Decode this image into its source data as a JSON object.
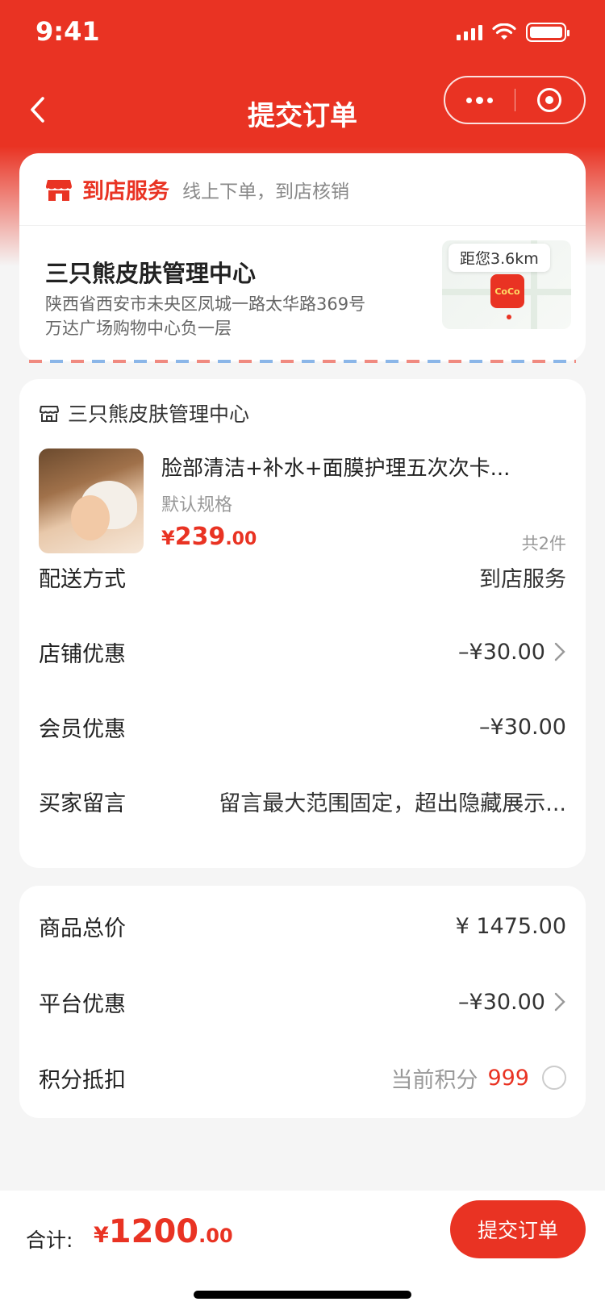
{
  "status_bar": {
    "time": "9:41"
  },
  "nav": {
    "title": "提交订单",
    "back_icon": "chevron-left-icon",
    "more_icon": "more-dots-icon",
    "close_icon": "target-icon"
  },
  "delivery_tab": {
    "title": "到店服务",
    "subtitle": "线上下单，到店核销",
    "icon": "shop-icon"
  },
  "store": {
    "name": "三只熊皮肤管理中心",
    "address_line1": "陕西省西安市未央区凤城一路太华路369号",
    "address_line2": "万达广场购物中心负一层",
    "distance": "距您3.6km"
  },
  "order": {
    "shop_name": "三只熊皮肤管理中心",
    "product": {
      "title": "脸部清洁+补水+面膜护理五次次卡...",
      "spec": "默认规格",
      "price_symbol": "¥",
      "price_int": "239",
      "price_dec": ".00",
      "quantity": "共2件"
    },
    "rows": {
      "delivery": {
        "label": "配送方式",
        "value": "到店服务"
      },
      "store_discount": {
        "label": "店铺优惠",
        "value": "–¥30.00"
      },
      "member_discount": {
        "label": "会员优惠",
        "value": "–¥30.00"
      },
      "buyer_message": {
        "label": "买家留言",
        "value": "留言最大范围固定，超出隐藏展示..."
      }
    }
  },
  "totals": {
    "goods_total": {
      "label": "商品总价",
      "value": "¥ 1475.00"
    },
    "platform_discount": {
      "label": "平台优惠",
      "value": "–¥30.00"
    },
    "points": {
      "label": "积分抵扣",
      "current_label": "当前积分",
      "current_value": "999"
    }
  },
  "bottom": {
    "sum_label": "合计:",
    "price_symbol": "¥",
    "price_int": "1200",
    "price_dec": ".00",
    "submit_label": "提交订单"
  },
  "colors": {
    "accent": "#e93323",
    "background": "#f5f5f5"
  }
}
